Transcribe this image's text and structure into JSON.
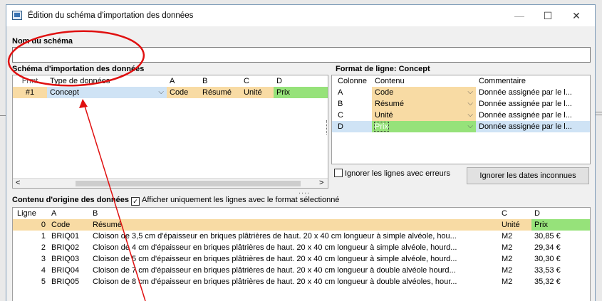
{
  "window": {
    "title": "Édition du schéma d'importation des données",
    "minimize": "—",
    "maximize": "☐",
    "close": "✕"
  },
  "schema_name": {
    "label": "Nom du schéma",
    "value": ""
  },
  "import_schema": {
    "label": "Schéma d'importation des données",
    "headers": [
      "Frmt",
      "Type de données",
      "A",
      "B",
      "C",
      "D"
    ],
    "rows": [
      {
        "frmt": "#1",
        "type": "Concept",
        "a": "Code",
        "b": "Résumé",
        "c": "Unité",
        "d": "Prix"
      }
    ]
  },
  "line_format": {
    "label": "Format de ligne: Concept",
    "headers": [
      "Colonne",
      "Contenu",
      "Commentaire"
    ],
    "rows": [
      {
        "col": "A",
        "content": "Code",
        "comment": "Donnée assignée par le l..."
      },
      {
        "col": "B",
        "content": "Résumé",
        "comment": "Donnée assignée par le l..."
      },
      {
        "col": "C",
        "content": "Unité",
        "comment": "Donnée assignée par le l..."
      },
      {
        "col": "D",
        "content": "Prix",
        "comment": "Donnée assignée par le l..."
      }
    ]
  },
  "ignore_errors": {
    "label": "Ignorer les lignes avec erreurs",
    "checked": false
  },
  "ignore_dates_button": "Ignorer les dates inconnues",
  "original_content": {
    "label": "Contenu d'origine des données",
    "filter": {
      "label": "Afficher uniquement les lignes avec le format sélectionné",
      "checked": true
    },
    "headers": [
      "Ligne",
      "A",
      "B",
      "C",
      "D"
    ],
    "rows": [
      {
        "n": "0",
        "a": "Code",
        "b": "Résumé",
        "c": "Unité",
        "d": "Prix"
      },
      {
        "n": "1",
        "a": "BRIQ01",
        "b": "Cloison de 3,5 cm d'épaisseur en briques plâtrières de haut. 20 x 40 cm longueur à simple alvéole, hou...",
        "c": "M2",
        "d": "30,85 €"
      },
      {
        "n": "2",
        "a": "BRIQ02",
        "b": "Cloison de 4 cm d'épaisseur en briques plâtrières de haut. 20 x 40 cm longueur à simple alvéole, hourd...",
        "c": "M2",
        "d": "29,34 €"
      },
      {
        "n": "3",
        "a": "BRIQ03",
        "b": "Cloison de 5 cm d'épaisseur en briques plâtrières de haut. 20 x 40 cm longueur à simple alvéole, hourd...",
        "c": "M2",
        "d": "30,30 €"
      },
      {
        "n": "4",
        "a": "BRIQ04",
        "b": "Cloison de 7 cm d'épaisseur en briques plâtrières de haut. 20 x 40 cm longueur à double alvéole hourd...",
        "c": "M2",
        "d": "33,53 €"
      },
      {
        "n": "5",
        "a": "BRIQ05",
        "b": "Cloison de 8 cm d'épaisseur en briques plâtrières de haut. 20 x 40 cm longueur à double alvéoles, hour...",
        "c": "M2",
        "d": "35,32 €"
      }
    ]
  },
  "colors": {
    "annotation": "#e01010",
    "orange_cell": "#f8dba4",
    "green_cell": "#96e27a",
    "selection": "#cfe3f5"
  }
}
